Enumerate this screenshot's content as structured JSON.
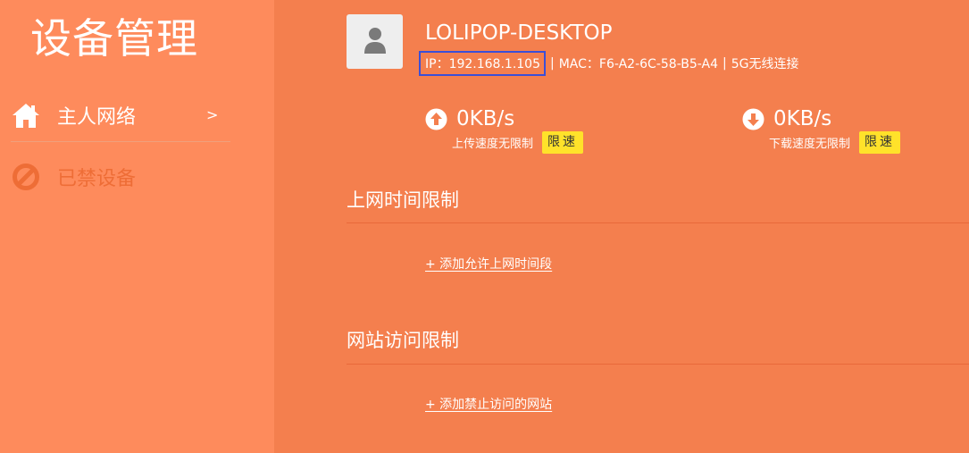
{
  "sidebar": {
    "title": "设备管理",
    "items": [
      {
        "label": "主人网络",
        "arrow": ">",
        "icon": "home-icon",
        "active": true
      },
      {
        "label": "已禁设备",
        "icon": "block-icon",
        "active": false
      }
    ]
  },
  "device": {
    "avatar_icon": "user-icon",
    "name": "LOLIPOP-DESKTOP",
    "ip": "IP：192.168.1.105",
    "separator": "|",
    "mac": "MAC：F6-A2-6C-58-B5-A4",
    "connection": "5G无线连接"
  },
  "speeds": {
    "upload": {
      "icon": "upload-arrow-icon",
      "value": "0KB/s",
      "label": "上传速度无限制",
      "button": "限速"
    },
    "download": {
      "icon": "download-arrow-icon",
      "value": "0KB/s",
      "label": "下载速度无限制",
      "button": "限速"
    }
  },
  "sections": {
    "time_limit": {
      "title": "上网时间限制",
      "add_label": "+ 添加允许上网时间段"
    },
    "site_limit": {
      "title": "网站访问限制",
      "add_label": "+ 添加禁止访问的网站"
    }
  },
  "colors": {
    "background": "#f47f4e",
    "sidebar": "#fe8b5c",
    "highlight_box": "#3a4fd8",
    "limit_button": "#ffe22a"
  }
}
